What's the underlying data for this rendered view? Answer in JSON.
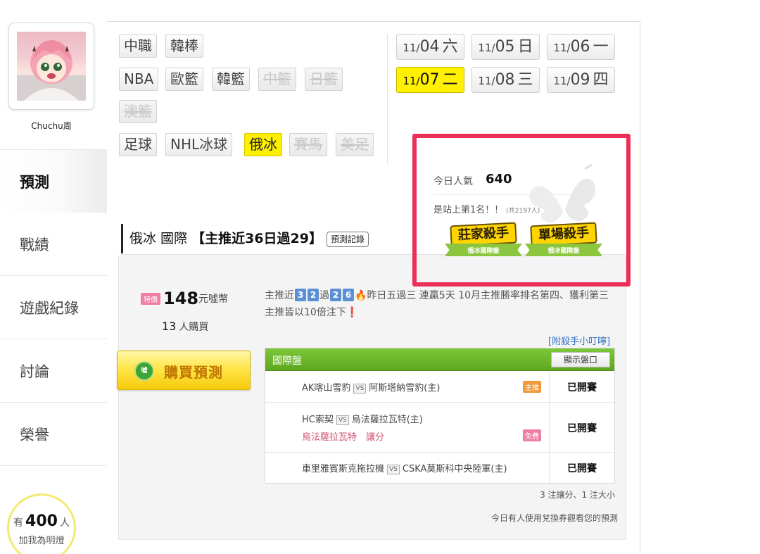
{
  "profile": {
    "username": "Chuchu周"
  },
  "nav": {
    "items": [
      {
        "label": "預測"
      },
      {
        "label": "戰績"
      },
      {
        "label": "遊戲紀錄"
      },
      {
        "label": "討論"
      },
      {
        "label": "榮譽"
      }
    ]
  },
  "lamp": {
    "prefix": "有",
    "count": "400",
    "suffix": "人",
    "cta": "加我為明燈"
  },
  "leagues": {
    "row1": [
      {
        "label": "中職"
      },
      {
        "label": "韓棒"
      }
    ],
    "row2": [
      {
        "label": "NBA"
      },
      {
        "label": "歐籃"
      },
      {
        "label": "韓籃"
      },
      {
        "label": "中籃"
      },
      {
        "label": "日籃"
      }
    ],
    "row3": [
      {
        "label": "澳籃"
      }
    ],
    "row4": [
      {
        "label": "足球"
      },
      {
        "label": "NHL冰球"
      },
      {
        "label": "俄冰"
      },
      {
        "label": "賽馬"
      },
      {
        "label": "美足"
      }
    ]
  },
  "dates": [
    {
      "month": "11/",
      "day": "04",
      "weekday": "六"
    },
    {
      "month": "11/",
      "day": "05",
      "weekday": "日"
    },
    {
      "month": "11/",
      "day": "06",
      "weekday": "一"
    },
    {
      "month": "11/",
      "day": "07",
      "weekday": "二"
    },
    {
      "month": "11/",
      "day": "08",
      "weekday": "三"
    },
    {
      "month": "11/",
      "day": "09",
      "weekday": "四"
    }
  ],
  "popularity": {
    "label": "今日人氣",
    "value": "640",
    "rank_text": "是站上第1名！！",
    "rank_total": "(共2197人)"
  },
  "badges": [
    {
      "title": "莊家殺手",
      "subtitle": "俄冰國際盤"
    },
    {
      "title": "單場殺手",
      "subtitle": "俄冰國際盤"
    }
  ],
  "heading": {
    "league": "俄冰 國際",
    "record": "【主推近36日過29】",
    "record_button": "預測記錄"
  },
  "price": {
    "tag": "特價",
    "value": "148",
    "unit": "元噓幣",
    "buyers_count": "13",
    "buyers_suffix": "人購買"
  },
  "buy_button": {
    "coin": "噓",
    "label": "購買預測"
  },
  "streak": {
    "prefix": "主推近",
    "digits_a": [
      "3",
      "2"
    ],
    "mid": "過",
    "digits_b": [
      "2",
      "6"
    ],
    "fire": "🔥",
    "text": "昨日五過三 連贏5天 10月主推勝率排名第四、獲利第三 主推皆以10倍注下",
    "excl": "❗"
  },
  "tips_link": "[附殺手小叮嚀]",
  "picks": {
    "title": "國際盤",
    "show_odds": "顯示盤口",
    "vs": "VS",
    "rows": [
      {
        "away": "AK喀山雪豹",
        "home": "阿斯塔納雪豹(主)",
        "tag": "主推",
        "pick": "",
        "status": "已開賽"
      },
      {
        "away": "HC索契",
        "home": "烏法薩拉瓦特(主)",
        "tag": "免費",
        "pick": "烏法薩拉瓦特　讓分",
        "status": "已開賽"
      },
      {
        "away": "車里雅賓斯克拖拉機",
        "home": "CSKA莫斯科中央陸軍(主)",
        "tag": "",
        "pick": "",
        "status": "已開賽"
      }
    ]
  },
  "summary": "3 注讓分、1 注大小",
  "voucher_text": "今日有人使用兌換券觀看您的預測",
  "colors": {
    "active_yellow": "#fff100",
    "highlight_red": "#ec2f58",
    "table_green": "#6cb82c",
    "link_blue": "#3272c6"
  }
}
